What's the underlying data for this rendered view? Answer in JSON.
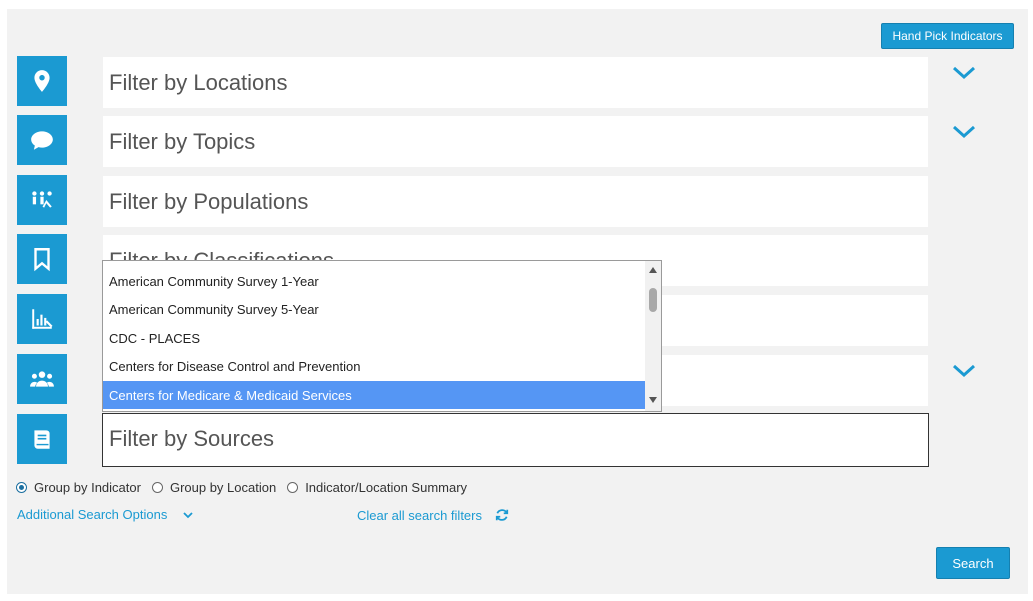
{
  "header": {
    "hand_pick_label": "Hand Pick Indicators"
  },
  "filters": [
    {
      "label": "Filter by Locations",
      "icon": "location-pin-icon",
      "expandable": true
    },
    {
      "label": "Filter by Topics",
      "icon": "speech-bubble-icon",
      "expandable": true
    },
    {
      "label": "Filter by Populations",
      "icon": "population-group-icon",
      "expandable": false
    },
    {
      "label": "Filter by Classifications",
      "icon": "bookmark-icon",
      "expandable": false
    },
    {
      "label": "",
      "icon": "chart-icon",
      "expandable": false
    },
    {
      "label": "",
      "icon": "people-icon",
      "expandable": true
    },
    {
      "label": "Filter by Sources",
      "icon": "book-icon",
      "expandable": false
    }
  ],
  "sources_dropdown": {
    "options": [
      "American Community Survey 1-Year",
      "American Community Survey 5-Year",
      "CDC - PLACES",
      "Centers for Disease Control and Prevention",
      "Centers for Medicare & Medicaid Services"
    ],
    "highlighted_index": 4
  },
  "grouping": {
    "options": [
      "Group by Indicator",
      "Group by Location",
      "Indicator/Location Summary"
    ],
    "selected": "Group by Indicator"
  },
  "links": {
    "additional_options": "Additional Search Options",
    "clear_filters": "Clear all search filters"
  },
  "search_label": "Search",
  "colors": {
    "accent": "#1b9ad2",
    "highlight": "#5596f4",
    "panel_bg": "#f2f2f2"
  }
}
